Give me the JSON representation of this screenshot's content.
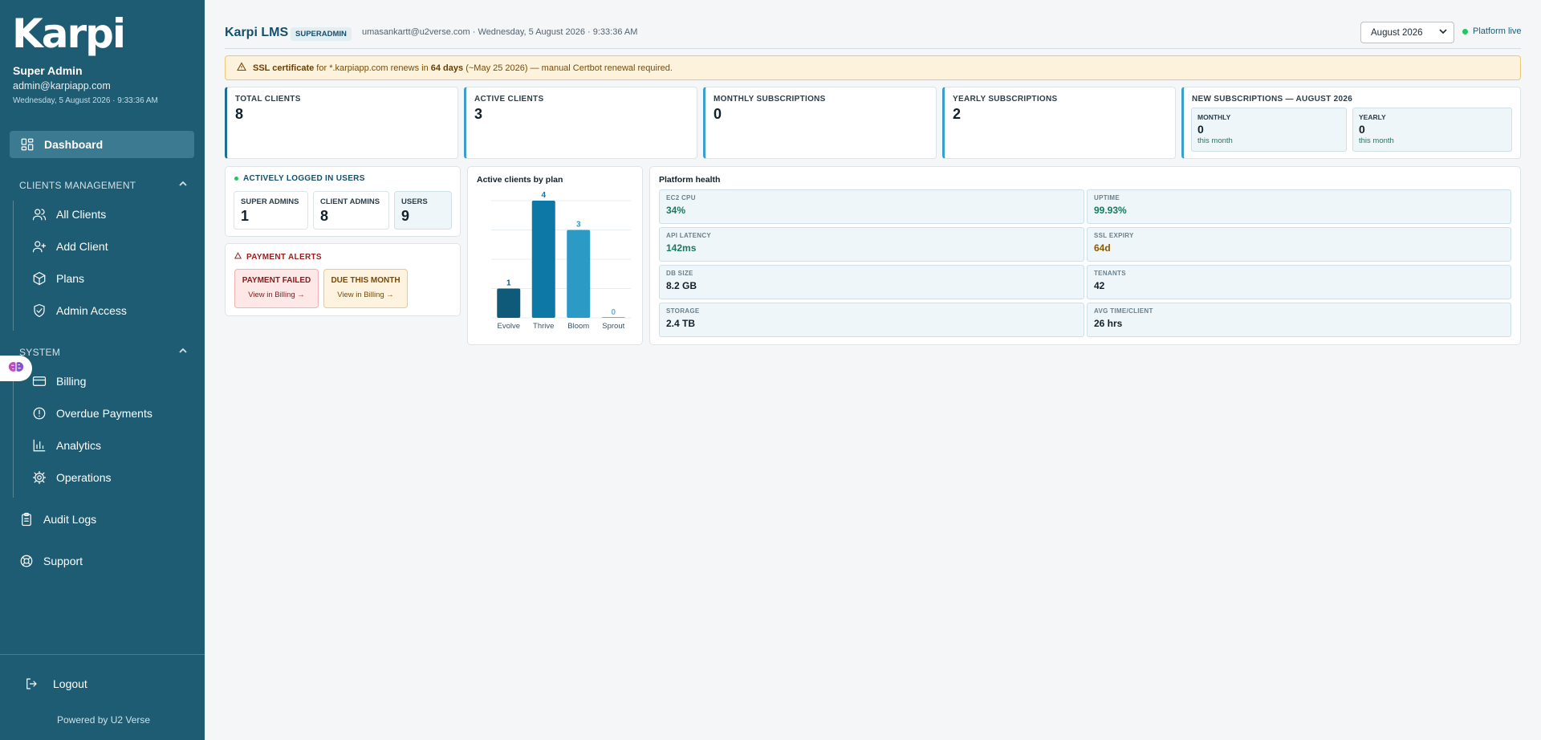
{
  "sidebar": {
    "logo": "Karpi",
    "user_name": "Super Admin",
    "user_email": "admin@karpiapp.com",
    "user_date": "Wednesday, 5 August 2026 · 9:33:36 AM",
    "dashboard": "Dashboard",
    "clients_section": "CLIENTS MANAGEMENT",
    "clients_items": [
      "All Clients",
      "Add Client",
      "Plans",
      "Admin Access"
    ],
    "system_section": "SYSTEM",
    "system_items": [
      "Billing",
      "Overdue Payments",
      "Analytics",
      "Operations"
    ],
    "audit_logs": "Audit Logs",
    "support": "Support",
    "logout": "Logout",
    "powered_by": "Powered by U2 Verse"
  },
  "header": {
    "title": "Karpi LMS",
    "role": "SUPERADMIN",
    "meta": "umasankartt@u2verse.com · Wednesday, 5 August 2026 · 9:33:36 AM",
    "month": "August 2026",
    "status": "Platform live"
  },
  "ssl": {
    "strong": "SSL certificate",
    "text1": "for *.karpiapp.com renews in",
    "days": "64 days",
    "text2": "(~May 25 2026) — manual Certbot renewal required."
  },
  "kpis": {
    "total_clients": {
      "label": "TOTAL CLIENTS",
      "value": "8"
    },
    "active_clients": {
      "label": "ACTIVE CLIENTS",
      "value": "3"
    },
    "monthly_subs": {
      "label": "MONTHLY SUBSCRIPTIONS",
      "value": "0"
    },
    "yearly_subs": {
      "label": "YEARLY SUBSCRIPTIONS",
      "value": "2"
    },
    "new_subs": {
      "label": "NEW SUBSCRIPTIONS — AUGUST 2026",
      "monthly": {
        "label": "MONTHLY",
        "value": "0",
        "sub": "this month"
      },
      "yearly": {
        "label": "YEARLY",
        "value": "0",
        "sub": "this month"
      }
    }
  },
  "logged_in": {
    "title": "ACTIVELY LOGGED IN USERS",
    "super_admins": {
      "label": "SUPER ADMINS",
      "value": "1"
    },
    "client_admins": {
      "label": "CLIENT ADMINS",
      "value": "8"
    },
    "users": {
      "label": "USERS",
      "value": "9"
    }
  },
  "payment_alerts": {
    "title": "PAYMENT ALERTS",
    "failed": {
      "label": "PAYMENT FAILED",
      "link": "View in Billing →"
    },
    "due": {
      "label": "DUE THIS MONTH",
      "link": "View in Billing →"
    }
  },
  "chart_data": {
    "type": "bar",
    "title": "Active clients by plan",
    "categories": [
      "Evolve",
      "Thrive",
      "Bloom",
      "Sprout"
    ],
    "values": [
      1,
      4,
      3,
      0
    ],
    "ylim": [
      0,
      4
    ],
    "grid": true,
    "colors": [
      "#0f5a78",
      "#0d77a6",
      "#2b9ac4",
      "#5fb6d8"
    ]
  },
  "health": {
    "title": "Platform health",
    "cells": [
      {
        "label": "EC2 CPU",
        "value": "34%",
        "color": "#1a7a5e"
      },
      {
        "label": "UPTIME",
        "value": "99.93%",
        "color": "#1a7a5e"
      },
      {
        "label": "API LATENCY",
        "value": "142ms",
        "color": "#1a7a5e"
      },
      {
        "label": "SSL EXPIRY",
        "value": "64d",
        "color": "#8a5a00"
      },
      {
        "label": "DB SIZE",
        "value": "8.2 GB",
        "color": "#12202a"
      },
      {
        "label": "TENANTS",
        "value": "42",
        "color": "#12202a"
      },
      {
        "label": "STORAGE",
        "value": "2.4 TB",
        "color": "#12202a"
      },
      {
        "label": "AVG TIME/CLIENT",
        "value": "26 hrs",
        "color": "#12202a"
      }
    ]
  }
}
